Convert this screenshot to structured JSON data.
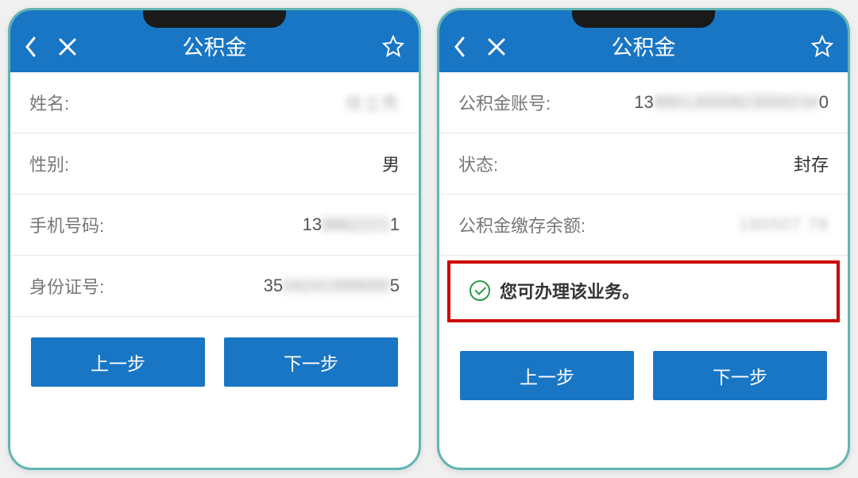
{
  "header": {
    "title": "公积金"
  },
  "left_screen": {
    "rows": {
      "name_label": "姓名:",
      "name_value": "徐立秀",
      "gender_label": "性别:",
      "gender_value": "男",
      "phone_label": "手机号码:",
      "phone_prefix": "13",
      "phone_mid": "8862221",
      "phone_suffix": "1",
      "id_label": "身份证号:",
      "id_prefix": "35",
      "id_mid": "04241999000",
      "id_suffix": "5"
    },
    "buttons": {
      "prev": "上一步",
      "next": "下一步"
    }
  },
  "right_screen": {
    "rows": {
      "account_label": "公积金账号:",
      "account_prefix": "13",
      "account_mid": "89013000823000234",
      "account_suffix": "0",
      "status_label": "状态:",
      "status_value": "封存",
      "balance_label": "公积金缴存余额:",
      "balance_value": "186507.78"
    },
    "notice": "您可办理该业务。",
    "buttons": {
      "prev": "上一步",
      "next": "下一步"
    }
  }
}
